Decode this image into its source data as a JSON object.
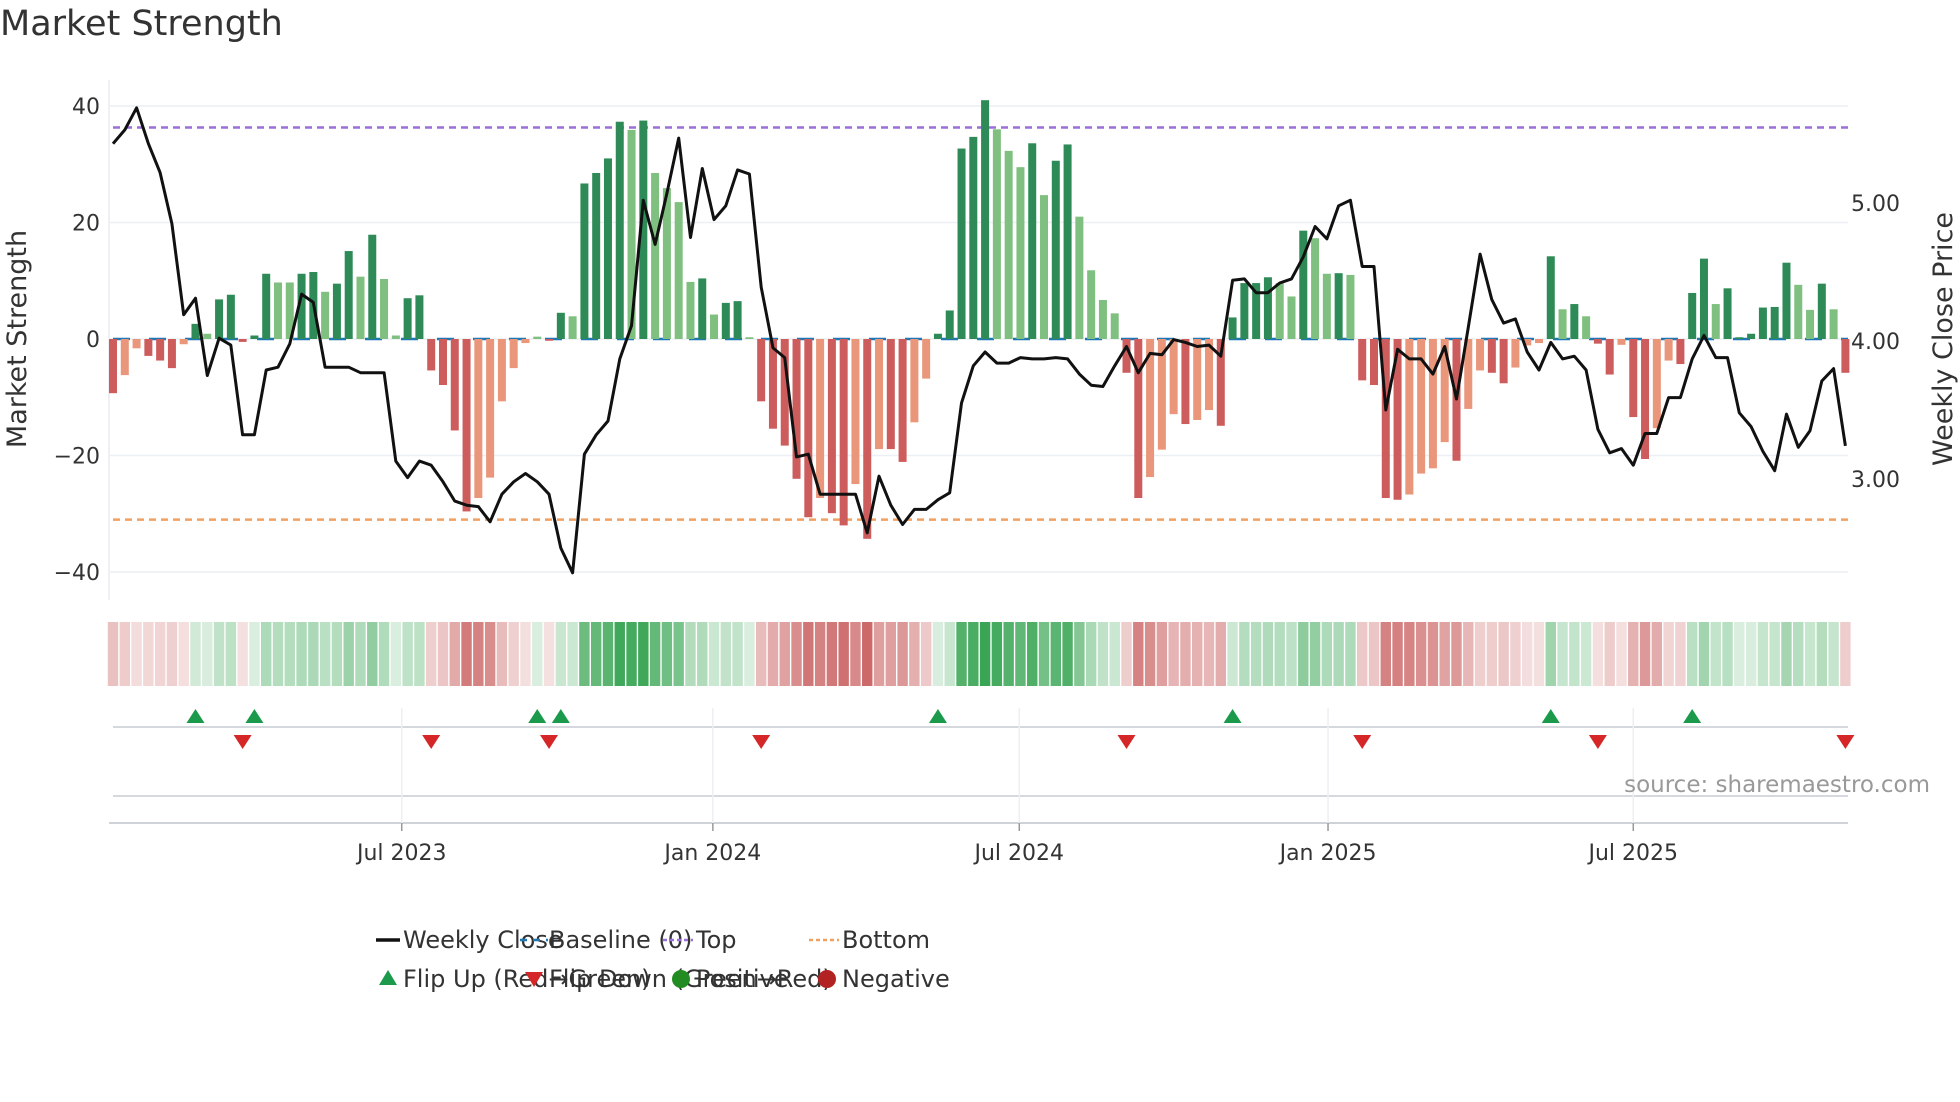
{
  "title": "Market Strength",
  "source": "source: sharemaestro.com",
  "chart_data": {
    "type": "bar",
    "title": "Market Strength",
    "ylabel": "Market Strength",
    "y2label": "Weekly Close Price",
    "ylim": [
      -43,
      43
    ],
    "yticks": [
      {
        "v": 40,
        "label": "40"
      },
      {
        "v": 20,
        "label": "20"
      },
      {
        "v": 0,
        "label": "0"
      },
      {
        "v": -20,
        "label": "−20"
      },
      {
        "v": -40,
        "label": "−40"
      }
    ],
    "y2ticks": [
      {
        "v": 5,
        "label": "5.00"
      },
      {
        "v": 4,
        "label": "4.00"
      },
      {
        "v": 3,
        "label": "3.00"
      }
    ],
    "xticks": [
      {
        "i": 24.5,
        "label": "Jul 2023"
      },
      {
        "i": 50.9,
        "label": "Jan 2024"
      },
      {
        "i": 76.9,
        "label": "Jul 2024"
      },
      {
        "i": 103.1,
        "label": "Jan 2025"
      },
      {
        "i": 129.0,
        "label": "Jul 2025"
      }
    ],
    "top_level": 36.3,
    "bottom_level": -31.0,
    "baseline": 0,
    "strength": [
      -9.3,
      -6.2,
      -1.6,
      -2.9,
      -3.7,
      -5.0,
      -0.9,
      2.6,
      0.9,
      6.8,
      7.6,
      -0.5,
      0.6,
      11.2,
      9.7,
      9.7,
      11.2,
      11.5,
      8.1,
      9.5,
      15.1,
      10.7,
      17.9,
      10.3,
      0.6,
      7.0,
      7.5,
      -5.4,
      -7.9,
      -15.7,
      -29.6,
      -27.3,
      -23.8,
      -10.7,
      -5.0,
      -0.7,
      0.4,
      -0.3,
      4.5,
      3.9,
      26.7,
      28.5,
      31.0,
      37.3,
      35.9,
      37.5,
      28.5,
      25.9,
      23.5,
      9.8,
      10.4,
      4.2,
      6.2,
      6.5,
      0.3,
      -10.7,
      -15.4,
      -18.3,
      -24.0,
      -30.6,
      -27.3,
      -29.9,
      -32.0,
      -24.9,
      -34.3,
      -18.9,
      -18.9,
      -21.1,
      -14.3,
      -6.8,
      0.9,
      4.9,
      32.7,
      34.7,
      41.0,
      36.0,
      32.3,
      29.5,
      33.6,
      24.7,
      30.6,
      33.4,
      21.0,
      11.8,
      6.7,
      4.4,
      -5.8,
      -27.3,
      -23.7,
      -19.0,
      -12.9,
      -14.6,
      -13.9,
      -12.2,
      -14.9,
      3.7,
      9.6,
      9.6,
      10.6,
      9.6,
      7.3,
      18.6,
      17.3,
      11.2,
      11.3,
      11.0,
      -7.1,
      -7.9,
      -27.3,
      -27.6,
      -26.7,
      -23.1,
      -22.2,
      -17.7,
      -20.9,
      -12.0,
      -5.4,
      -5.8,
      -7.6,
      -4.9,
      -1.1,
      -0.7,
      14.2,
      5.1,
      6.0,
      3.9,
      -0.8,
      -6.1,
      -1.0,
      -13.4,
      -20.6,
      -15.3,
      -3.7,
      -4.3,
      7.9,
      13.8,
      6.0,
      8.7,
      0.3,
      0.9,
      5.4,
      5.5,
      13.1,
      9.3,
      5.0,
      9.5,
      5.1,
      -5.8
    ],
    "shade": "dlldddldldddddllddlddldllddddddllllllddlddddldlllldlddlddddd lddldlddlldddddllldlddllllddllldlldddddlldlldldddd lllldllddllldldlddlddlldddlddddddlldld",
    "weekly_close": [
      5.43,
      5.53,
      5.69,
      5.43,
      5.22,
      4.85,
      4.19,
      4.31,
      3.75,
      4.02,
      3.97,
      3.32,
      3.32,
      3.79,
      3.81,
      3.98,
      4.34,
      4.28,
      3.81,
      3.81,
      3.81,
      3.77,
      3.77,
      3.77,
      3.13,
      3.01,
      3.13,
      3.1,
      2.98,
      2.84,
      2.81,
      2.8,
      2.69,
      2.89,
      2.98,
      3.04,
      2.98,
      2.89,
      2.5,
      2.32,
      3.18,
      3.32,
      3.42,
      3.87,
      4.11,
      5.02,
      4.7,
      5.07,
      5.47,
      4.75,
      5.25,
      4.88,
      4.98,
      5.24,
      5.21,
      4.39,
      3.95,
      3.88,
      3.16,
      3.18,
      2.89,
      2.89,
      2.89,
      2.89,
      2.61,
      3.02,
      2.81,
      2.67,
      2.78,
      2.78,
      2.85,
      2.9,
      3.55,
      3.82,
      3.92,
      3.84,
      3.84,
      3.88,
      3.87,
      3.87,
      3.88,
      3.87,
      3.76,
      3.68,
      3.67,
      3.82,
      3.96,
      3.77,
      3.91,
      3.9,
      4.01,
      3.99,
      3.96,
      3.97,
      3.89,
      4.44,
      4.45,
      4.35,
      4.35,
      4.42,
      4.45,
      4.61,
      4.83,
      4.74,
      4.98,
      5.02,
      4.54,
      4.54,
      3.5,
      3.94,
      3.87,
      3.87,
      3.76,
      3.96,
      3.58,
      4.1,
      4.63,
      4.3,
      4.13,
      4.16,
      3.92,
      3.79,
      3.99,
      3.87,
      3.89,
      3.79,
      3.36,
      3.19,
      3.22,
      3.1,
      3.33,
      3.33,
      3.59,
      3.59,
      3.87,
      4.04,
      3.88,
      3.88,
      3.48,
      3.38,
      3.2,
      3.06,
      3.47,
      3.23,
      3.35,
      3.71,
      3.8,
      3.24
    ],
    "flip_up": [
      7,
      12,
      36,
      38,
      70,
      95,
      122,
      134
    ],
    "flip_down": [
      11,
      27,
      37,
      55,
      86,
      106,
      126,
      147
    ],
    "legend": {
      "placement": "bottom",
      "items": [
        {
          "key": "close",
          "label": "Weekly Close"
        },
        {
          "key": "baseline",
          "label": "Baseline (0)"
        },
        {
          "key": "top",
          "label": "Top"
        },
        {
          "key": "bottom",
          "label": "Bottom"
        },
        {
          "key": "flip_up",
          "label": "Flip Up (Red→Green)"
        },
        {
          "key": "flip_down",
          "label": "Flip Down (Green→Red)"
        },
        {
          "key": "positive",
          "label": "Positive"
        },
        {
          "key": "negative",
          "label": "Negative"
        }
      ]
    },
    "colors": {
      "pos_dark": "#2e8b57",
      "pos_light": "#7fbf7f",
      "neg_dark": "#cd5c5c",
      "neg_light": "#e9967a",
      "baseline": "#1f77b4",
      "top": "#9b6fd8",
      "bottom": "#f0a060",
      "close": "#111111",
      "flip_up": "#1a9a4a",
      "flip_down": "#d62728",
      "positive": "#228b22",
      "negative": "#b22222",
      "heat_pos": "#3aa655",
      "heat_neg": "#c85a5a"
    }
  }
}
